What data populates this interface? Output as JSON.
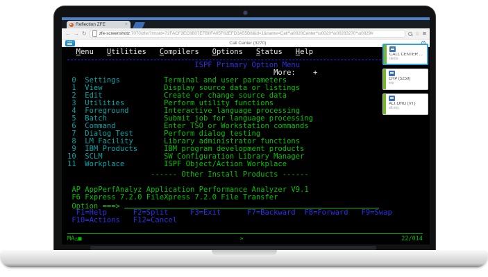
{
  "browser": {
    "tab_title": "Reflection ZFE",
    "tab_close": "×",
    "back_icon": "←",
    "forward_icon": "→",
    "reload_icon": "↻",
    "url_host": "zfe-screenshotz",
    "url_rest": ":7070/zfe/?rmsid=72FACF3EC6B07EFB0FA05F62EFD3A55B8&id=1&name=Call*\\u0020Center*\\u0020*\\u00283270*\\u0029#",
    "star_icon": "☆",
    "menu_icon": "≡",
    "gear_icon": "⚙"
  },
  "toolbar": {
    "session_title": "Call Center (3270)"
  },
  "terminal": {
    "menu_bar": {
      "menu": "Menu",
      "utilities": "Utilities",
      "compilers": "Compilers",
      "options": "Options",
      "status": "Status",
      "help": "Help"
    },
    "title": "ISPF Primary Option Menu",
    "more_label": "More:",
    "more_plus": "+",
    "options": [
      {
        "num": "0",
        "name": "Settings",
        "desc": "Terminal and user parameters"
      },
      {
        "num": "1",
        "name": "View",
        "desc": "Display source data or listings"
      },
      {
        "num": "2",
        "name": "Edit",
        "desc": "Create or change source data"
      },
      {
        "num": "3",
        "name": "Utilities",
        "desc": "Perform utility functions"
      },
      {
        "num": "4",
        "name": "Foreground",
        "desc": "Interactive language processing"
      },
      {
        "num": "5",
        "name": "Batch",
        "desc": "Submit job for language processing"
      },
      {
        "num": "6",
        "name": "Command",
        "desc": "Enter TSO or Workstation commands"
      },
      {
        "num": "7",
        "name": "Dialog Test",
        "desc": "Perform dialog testing"
      },
      {
        "num": "8",
        "name": "LM Facility",
        "desc": "Library administrator functions"
      },
      {
        "num": "9",
        "name": "IBM Products",
        "desc": "IBM program development products"
      },
      {
        "num": "10",
        "name": "SCLM",
        "desc": "SW Configuration Library Manager"
      },
      {
        "num": "11",
        "name": "Workplace",
        "desc": "ISPF Object/Action Workplace"
      }
    ],
    "section_divider": "------ Other Install Products ------",
    "product_line1": "AP AppPerfAnalyz Application Performance Analyzer V9.1",
    "product_line2": "F6 Fxpress 7.2.0 FileXpress 7.2.0 File Transfer",
    "option_prompt": "Option ===>",
    "fkeys_line1": "  F1=Help      F2=Split     F3=Exit      F7=Backward  F8=Forward   F9=Swap",
    "fkeys_line2": " F10=Actions   F12=Cancel",
    "oia": {
      "left": "MA△■",
      "center": "»",
      "right": "22/014"
    }
  },
  "sessions": [
    {
      "label": "CALL CENTER ...",
      "sub": "demo",
      "active": "true"
    },
    {
      "label": "ERP (5250)",
      "sub": "erp",
      "active": "false"
    },
    {
      "label": "ALT.ORG (VT)",
      "sub": "alt.org",
      "active": "false"
    }
  ],
  "colors": {
    "terminal_green": "#00C200",
    "terminal_teal": "#00A5A5",
    "terminal_blue": "#2E2EE6",
    "terminal_white": "#E6E6E6",
    "card_stripe_green": "#77B62C",
    "active_card_border": "#2F9FD8",
    "toolbar_button_blue": "#2BA3DC",
    "chrome_theme_blue": "#4D7FC2"
  }
}
